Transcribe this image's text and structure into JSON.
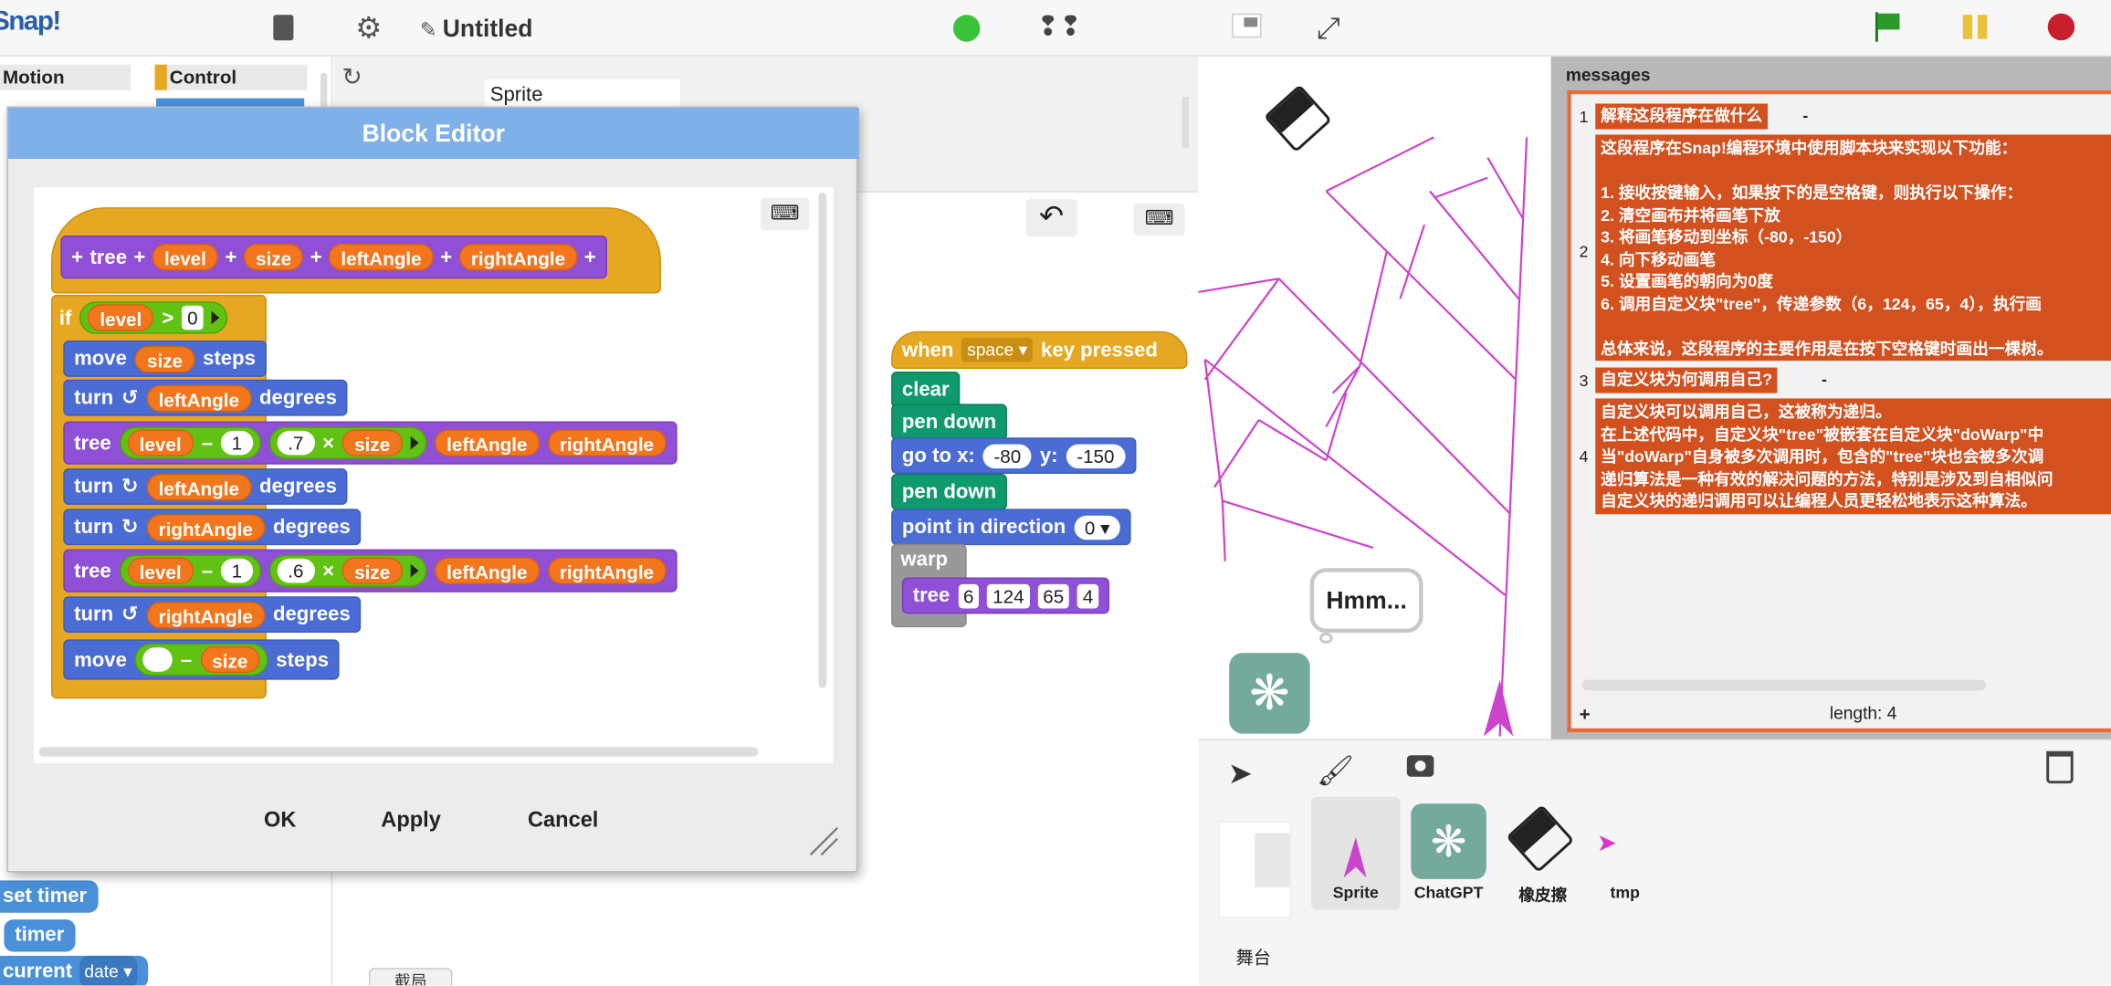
{
  "app": {
    "logo": "Snap!",
    "project_title": "Untitled"
  },
  "palette": {
    "categories": [
      "Motion",
      "Control"
    ],
    "blocks": [
      "set timer",
      "timer",
      "current",
      "date"
    ]
  },
  "sprite_name": "Sprite",
  "tabs": {
    "partial": "截局"
  },
  "block_editor": {
    "title": "Block Editor",
    "hat": {
      "name": "tree",
      "params": [
        "level",
        "size",
        "leftAngle",
        "rightAngle"
      ]
    },
    "if_label": "if",
    "level": "level",
    "gt": ">",
    "zero": "0",
    "move": "move",
    "size": "size",
    "steps": "steps",
    "turn": "turn",
    "leftAngle": "leftAngle",
    "rightAngle": "rightAngle",
    "degrees": "degrees",
    "tree": "tree",
    "minus": "–",
    "one": "1",
    "times": "×",
    "p7": ".7",
    "p6": ".6",
    "ok": "OK",
    "apply": "Apply",
    "cancel": "Cancel"
  },
  "script": {
    "when": "when",
    "key": "space",
    "key_pressed": "key pressed",
    "clear": "clear",
    "pen_down": "pen down",
    "go_to_x": "go to x:",
    "x_val": "-80",
    "y_label": "y:",
    "y_val": "-150",
    "point_in_direction": "point in direction",
    "dir_val": "0",
    "warp": "warp",
    "tree": "tree",
    "args": [
      "6",
      "124",
      "65",
      "4"
    ]
  },
  "speech": "Hmm...",
  "watcher": {
    "label": "messages",
    "rows": [
      {
        "index": "1",
        "text": "解释这段程序在做什么",
        "dash": "-"
      },
      {
        "index": "2",
        "lines": [
          "这段程序在Snap!编程环境中使用脚本块来实现以下功能：",
          "",
          "1. 接收按键输入，如果按下的是空格键，则执行以下操作：",
          "2. 清空画布并将画笔下放",
          "3. 将画笔移动到坐标（-80，-150）",
          "4. 向下移动画笔",
          "5. 设置画笔的朝向为0度",
          "6. 调用自定义块\"tree\"，传递参数（6，124，65，4），执行画",
          "",
          "总体来说，这段程序的主要作用是在按下空格键时画出一棵树。"
        ]
      },
      {
        "index": "3",
        "text": "自定义块为何调用自己?",
        "dash": "-"
      },
      {
        "index": "4",
        "lines": [
          "自定义块可以调用自己，这被称为递归。",
          "在上述代码中，自定义块\"tree\"被嵌套在自定义块\"doWarp\"中",
          "当\"doWarp\"自身被多次调用时，包含的\"tree\"块也会被多次调",
          "递归算法是一种有效的解决问题的方法，特别是涉及到自相似问",
          "自定义块的递归调用可以让编程人员更轻松地表示这种算法。"
        ]
      }
    ],
    "plus": "+",
    "length": "length: 4"
  },
  "corral": {
    "sprites": [
      "Sprite",
      "ChatGPT",
      "橡皮擦",
      "tmp"
    ],
    "stage": "舞台"
  },
  "colors": {
    "titlebar": "#7fb0e9",
    "message_cell": "#d3501f",
    "tree_line": "#cc44cc"
  }
}
